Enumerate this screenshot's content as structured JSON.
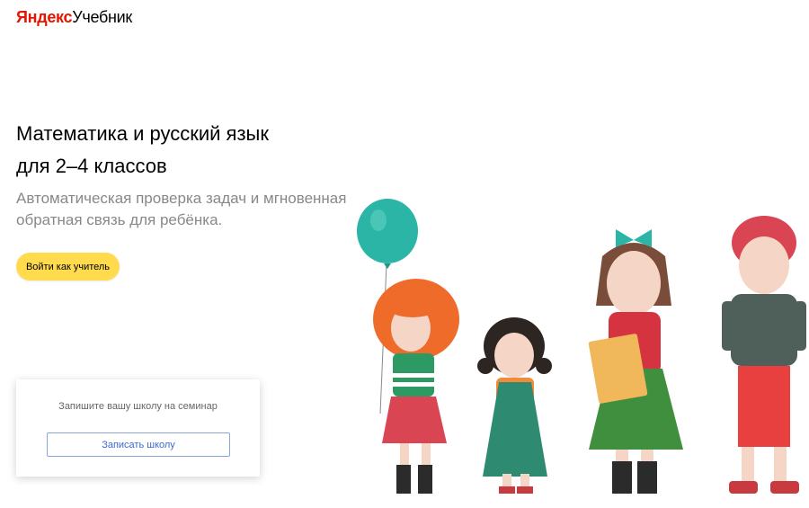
{
  "header": {
    "logo_brand": "Яндекс",
    "logo_product": "Учебник"
  },
  "hero": {
    "title_line1": "Математика и русский язык",
    "title_line2": "для 2–4 классов",
    "subtitle_line1": "Автоматическая проверка задач и мгновенная",
    "subtitle_line2": "обратная связь для ребёнка.",
    "login_button_label": "Войти как учитель"
  },
  "seminar_card": {
    "title": "Запишите вашу школу на семинар",
    "button_label": "Записать школу"
  },
  "colors": {
    "brand_red": "#e61400",
    "button_yellow": "#ffdb4d",
    "link_blue": "#3d6ac9",
    "balloon": "#2bb5a6"
  }
}
